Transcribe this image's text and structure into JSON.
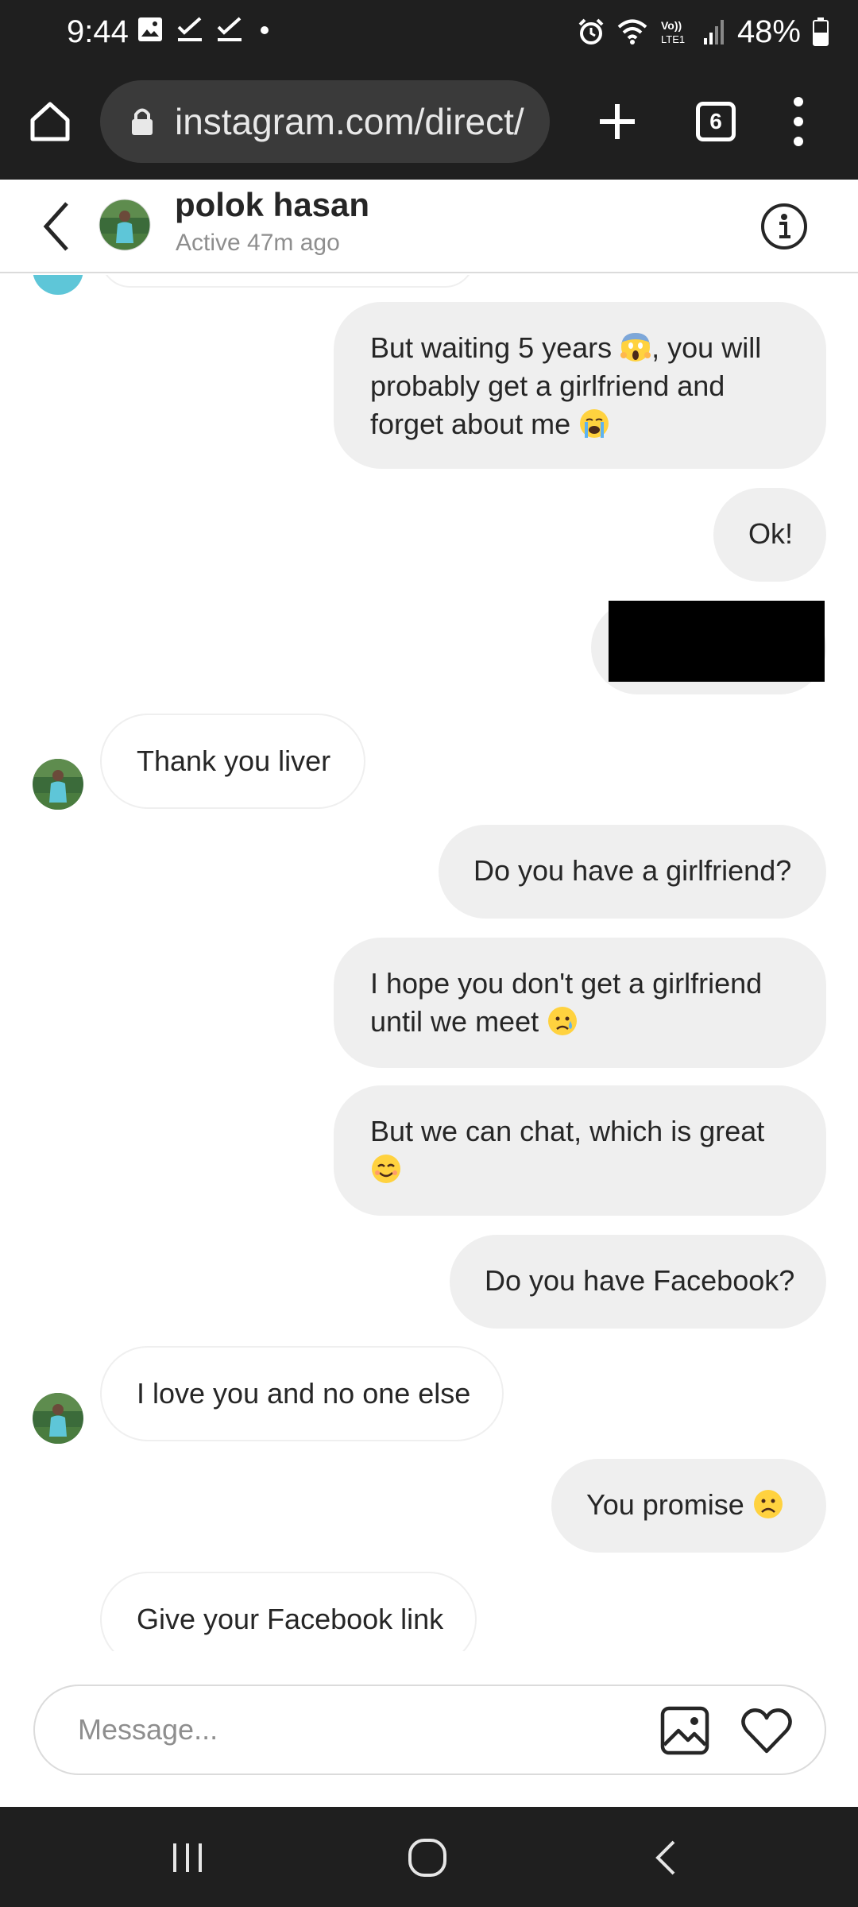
{
  "status_bar": {
    "time": "9:44",
    "battery": "48%",
    "left_icons": [
      "image-icon",
      "check-icon",
      "check-icon",
      "dot-icon"
    ],
    "right_icons": [
      "alarm-icon",
      "wifi-icon",
      "volte-icon",
      "signal-icon",
      "battery-icon"
    ],
    "network_label": "Vo)) LTE1"
  },
  "browser": {
    "url": "instagram.com/direct/",
    "tab_count": "6"
  },
  "chat_header": {
    "name": "polok hasan",
    "status": "Active 47m ago"
  },
  "messages": [
    {
      "sender": "me",
      "lines": [
        "But waiting 5 years ",
        ", you will",
        "probably get a girlfriend and",
        "forget about me "
      ],
      "emojis": [
        "scream-emoji",
        "crying-emoji"
      ]
    },
    {
      "sender": "me",
      "text": "Ok!"
    },
    {
      "sender": "me",
      "text": "",
      "redacted": true
    },
    {
      "sender": "them",
      "text": "Thank you liver"
    },
    {
      "sender": "me",
      "text": "Do you have a girlfriend?"
    },
    {
      "sender": "me",
      "lines": [
        "I hope you don't get a girlfriend",
        "until we meet "
      ],
      "emojis": [
        "sad-tear-emoji"
      ]
    },
    {
      "sender": "me",
      "lines": [
        "But we can chat, which is great",
        ""
      ],
      "emojis": [
        "smiling-emoji"
      ]
    },
    {
      "sender": "me",
      "text": "Do you have Facebook?"
    },
    {
      "sender": "them",
      "text": "I love you and no one else"
    },
    {
      "sender": "me",
      "text": "You promise ",
      "emojis": [
        "frowning-emoji"
      ]
    },
    {
      "sender": "them",
      "text": "Give your Facebook link"
    }
  ],
  "composer": {
    "placeholder": "Message..."
  },
  "colors": {
    "chrome_background": "#1f1f1f",
    "url_box": "#3a3a3a",
    "my_bubble": "#efefef",
    "text_primary": "#262626",
    "text_secondary": "#8e8e8e",
    "divider": "#dbdbdb"
  }
}
